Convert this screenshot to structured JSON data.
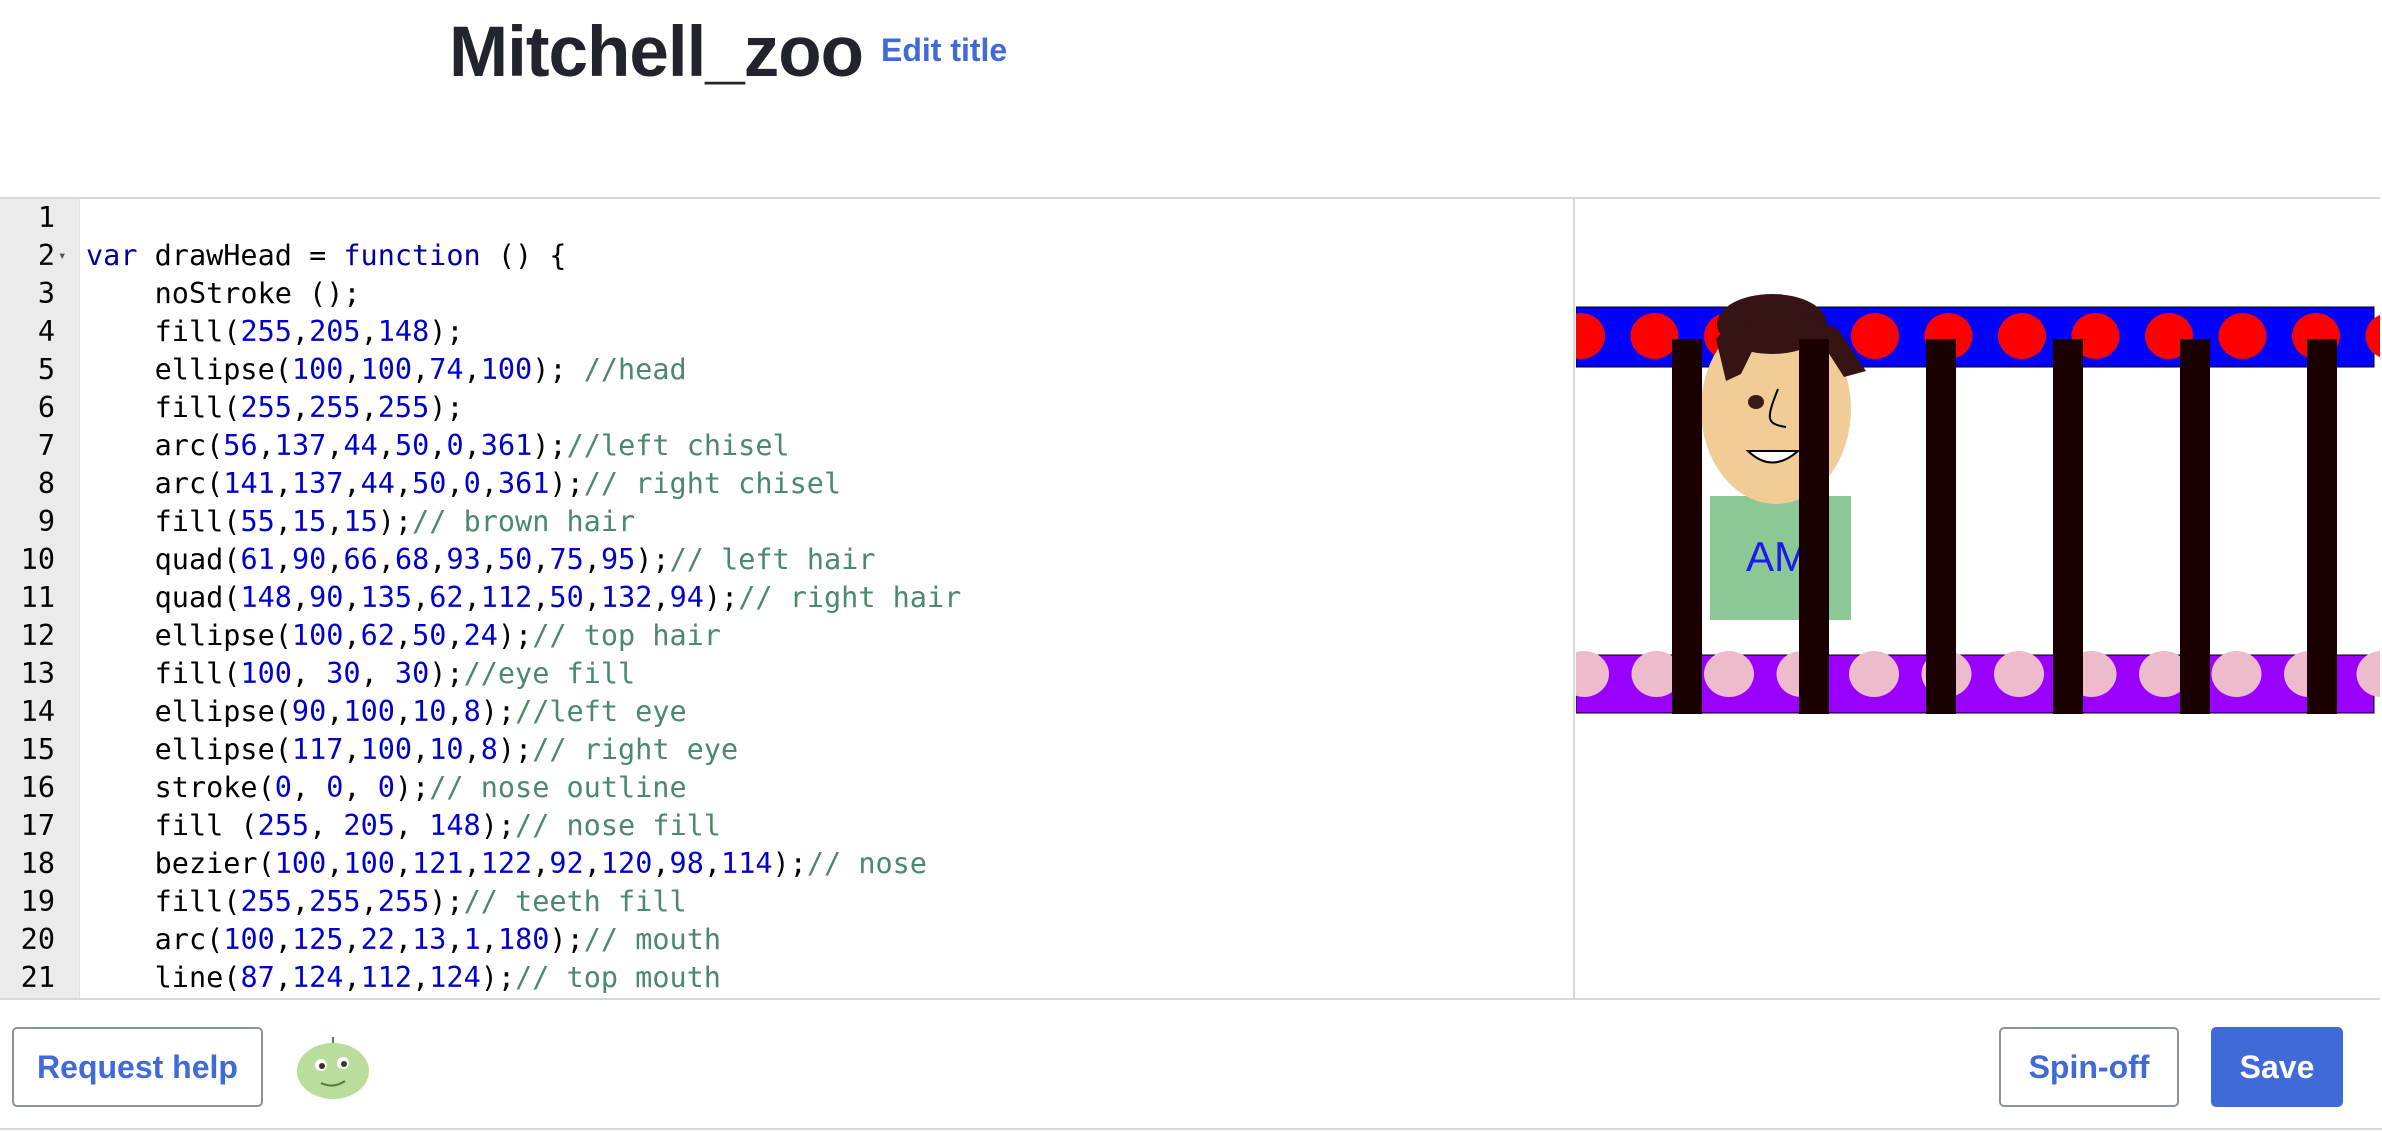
{
  "header": {
    "title": "Mitchell_zoo",
    "edit_title_label": "Edit title"
  },
  "editor": {
    "lines": [
      {
        "num": "1",
        "fold": false,
        "tokens": []
      },
      {
        "num": "2",
        "fold": true,
        "tokens": [
          [
            "kw",
            "var"
          ],
          [
            "fn",
            " drawHead = "
          ],
          [
            "kw",
            "function"
          ],
          [
            "fn",
            " () {"
          ]
        ]
      },
      {
        "num": "3",
        "fold": false,
        "tokens": [
          [
            "fn",
            "    noStroke ();"
          ]
        ]
      },
      {
        "num": "4",
        "fold": false,
        "tokens": [
          [
            "fn",
            "    fill("
          ],
          [
            "num",
            "255"
          ],
          [
            "fn",
            ","
          ],
          [
            "num",
            "205"
          ],
          [
            "fn",
            ","
          ],
          [
            "num",
            "148"
          ],
          [
            "fn",
            ");"
          ]
        ]
      },
      {
        "num": "5",
        "fold": false,
        "tokens": [
          [
            "fn",
            "    ellipse("
          ],
          [
            "num",
            "100"
          ],
          [
            "fn",
            ","
          ],
          [
            "num",
            "100"
          ],
          [
            "fn",
            ","
          ],
          [
            "num",
            "74"
          ],
          [
            "fn",
            ","
          ],
          [
            "num",
            "100"
          ],
          [
            "fn",
            "); "
          ],
          [
            "cm",
            "//head"
          ]
        ]
      },
      {
        "num": "6",
        "fold": false,
        "tokens": [
          [
            "fn",
            "    fill("
          ],
          [
            "num",
            "255"
          ],
          [
            "fn",
            ","
          ],
          [
            "num",
            "255"
          ],
          [
            "fn",
            ","
          ],
          [
            "num",
            "255"
          ],
          [
            "fn",
            ");"
          ]
        ]
      },
      {
        "num": "7",
        "fold": false,
        "tokens": [
          [
            "fn",
            "    arc("
          ],
          [
            "num",
            "56"
          ],
          [
            "fn",
            ","
          ],
          [
            "num",
            "137"
          ],
          [
            "fn",
            ","
          ],
          [
            "num",
            "44"
          ],
          [
            "fn",
            ","
          ],
          [
            "num",
            "50"
          ],
          [
            "fn",
            ","
          ],
          [
            "num",
            "0"
          ],
          [
            "fn",
            ","
          ],
          [
            "num",
            "361"
          ],
          [
            "fn",
            ");"
          ],
          [
            "cm",
            "//left chisel"
          ]
        ]
      },
      {
        "num": "8",
        "fold": false,
        "tokens": [
          [
            "fn",
            "    arc("
          ],
          [
            "num",
            "141"
          ],
          [
            "fn",
            ","
          ],
          [
            "num",
            "137"
          ],
          [
            "fn",
            ","
          ],
          [
            "num",
            "44"
          ],
          [
            "fn",
            ","
          ],
          [
            "num",
            "50"
          ],
          [
            "fn",
            ","
          ],
          [
            "num",
            "0"
          ],
          [
            "fn",
            ","
          ],
          [
            "num",
            "361"
          ],
          [
            "fn",
            ");"
          ],
          [
            "cm",
            "// right chisel"
          ]
        ]
      },
      {
        "num": "9",
        "fold": false,
        "tokens": [
          [
            "fn",
            "    fill("
          ],
          [
            "num",
            "55"
          ],
          [
            "fn",
            ","
          ],
          [
            "num",
            "15"
          ],
          [
            "fn",
            ","
          ],
          [
            "num",
            "15"
          ],
          [
            "fn",
            ");"
          ],
          [
            "cm",
            "// brown hair"
          ]
        ]
      },
      {
        "num": "10",
        "fold": false,
        "tokens": [
          [
            "fn",
            "    quad("
          ],
          [
            "num",
            "61"
          ],
          [
            "fn",
            ","
          ],
          [
            "num",
            "90"
          ],
          [
            "fn",
            ","
          ],
          [
            "num",
            "66"
          ],
          [
            "fn",
            ","
          ],
          [
            "num",
            "68"
          ],
          [
            "fn",
            ","
          ],
          [
            "num",
            "93"
          ],
          [
            "fn",
            ","
          ],
          [
            "num",
            "50"
          ],
          [
            "fn",
            ","
          ],
          [
            "num",
            "75"
          ],
          [
            "fn",
            ","
          ],
          [
            "num",
            "95"
          ],
          [
            "fn",
            ");"
          ],
          [
            "cm",
            "// left hair"
          ]
        ]
      },
      {
        "num": "11",
        "fold": false,
        "tokens": [
          [
            "fn",
            "    quad("
          ],
          [
            "num",
            "148"
          ],
          [
            "fn",
            ","
          ],
          [
            "num",
            "90"
          ],
          [
            "fn",
            ","
          ],
          [
            "num",
            "135"
          ],
          [
            "fn",
            ","
          ],
          [
            "num",
            "62"
          ],
          [
            "fn",
            ","
          ],
          [
            "num",
            "112"
          ],
          [
            "fn",
            ","
          ],
          [
            "num",
            "50"
          ],
          [
            "fn",
            ","
          ],
          [
            "num",
            "132"
          ],
          [
            "fn",
            ","
          ],
          [
            "num",
            "94"
          ],
          [
            "fn",
            ");"
          ],
          [
            "cm",
            "// right hair"
          ]
        ]
      },
      {
        "num": "12",
        "fold": false,
        "tokens": [
          [
            "fn",
            "    ellipse("
          ],
          [
            "num",
            "100"
          ],
          [
            "fn",
            ","
          ],
          [
            "num",
            "62"
          ],
          [
            "fn",
            ","
          ],
          [
            "num",
            "50"
          ],
          [
            "fn",
            ","
          ],
          [
            "num",
            "24"
          ],
          [
            "fn",
            ");"
          ],
          [
            "cm",
            "// top hair"
          ]
        ]
      },
      {
        "num": "13",
        "fold": false,
        "tokens": [
          [
            "fn",
            "    fill("
          ],
          [
            "num",
            "100"
          ],
          [
            "fn",
            ", "
          ],
          [
            "num",
            "30"
          ],
          [
            "fn",
            ", "
          ],
          [
            "num",
            "30"
          ],
          [
            "fn",
            ");"
          ],
          [
            "cm",
            "//eye fill"
          ]
        ]
      },
      {
        "num": "14",
        "fold": false,
        "tokens": [
          [
            "fn",
            "    ellipse("
          ],
          [
            "num",
            "90"
          ],
          [
            "fn",
            ","
          ],
          [
            "num",
            "100"
          ],
          [
            "fn",
            ","
          ],
          [
            "num",
            "10"
          ],
          [
            "fn",
            ","
          ],
          [
            "num",
            "8"
          ],
          [
            "fn",
            ");"
          ],
          [
            "cm",
            "//left eye"
          ]
        ]
      },
      {
        "num": "15",
        "fold": false,
        "tokens": [
          [
            "fn",
            "    ellipse("
          ],
          [
            "num",
            "117"
          ],
          [
            "fn",
            ","
          ],
          [
            "num",
            "100"
          ],
          [
            "fn",
            ","
          ],
          [
            "num",
            "10"
          ],
          [
            "fn",
            ","
          ],
          [
            "num",
            "8"
          ],
          [
            "fn",
            ");"
          ],
          [
            "cm",
            "// right eye"
          ]
        ]
      },
      {
        "num": "16",
        "fold": false,
        "tokens": [
          [
            "fn",
            "    stroke("
          ],
          [
            "num",
            "0"
          ],
          [
            "fn",
            ", "
          ],
          [
            "num",
            "0"
          ],
          [
            "fn",
            ", "
          ],
          [
            "num",
            "0"
          ],
          [
            "fn",
            ");"
          ],
          [
            "cm",
            "// nose outline"
          ]
        ]
      },
      {
        "num": "17",
        "fold": false,
        "tokens": [
          [
            "fn",
            "    fill ("
          ],
          [
            "num",
            "255"
          ],
          [
            "fn",
            ", "
          ],
          [
            "num",
            "205"
          ],
          [
            "fn",
            ", "
          ],
          [
            "num",
            "148"
          ],
          [
            "fn",
            ");"
          ],
          [
            "cm",
            "// nose fill"
          ]
        ]
      },
      {
        "num": "18",
        "fold": false,
        "tokens": [
          [
            "fn",
            "    bezier("
          ],
          [
            "num",
            "100"
          ],
          [
            "fn",
            ","
          ],
          [
            "num",
            "100"
          ],
          [
            "fn",
            ","
          ],
          [
            "num",
            "121"
          ],
          [
            "fn",
            ","
          ],
          [
            "num",
            "122"
          ],
          [
            "fn",
            ","
          ],
          [
            "num",
            "92"
          ],
          [
            "fn",
            ","
          ],
          [
            "num",
            "120"
          ],
          [
            "fn",
            ","
          ],
          [
            "num",
            "98"
          ],
          [
            "fn",
            ","
          ],
          [
            "num",
            "114"
          ],
          [
            "fn",
            ");"
          ],
          [
            "cm",
            "// nose"
          ]
        ]
      },
      {
        "num": "19",
        "fold": false,
        "tokens": [
          [
            "fn",
            "    fill("
          ],
          [
            "num",
            "255"
          ],
          [
            "fn",
            ","
          ],
          [
            "num",
            "255"
          ],
          [
            "fn",
            ","
          ],
          [
            "num",
            "255"
          ],
          [
            "fn",
            ");"
          ],
          [
            "cm",
            "// teeth fill"
          ]
        ]
      },
      {
        "num": "20",
        "fold": false,
        "tokens": [
          [
            "fn",
            "    arc("
          ],
          [
            "num",
            "100"
          ],
          [
            "fn",
            ","
          ],
          [
            "num",
            "125"
          ],
          [
            "fn",
            ","
          ],
          [
            "num",
            "22"
          ],
          [
            "fn",
            ","
          ],
          [
            "num",
            "13"
          ],
          [
            "fn",
            ","
          ],
          [
            "num",
            "1"
          ],
          [
            "fn",
            ","
          ],
          [
            "num",
            "180"
          ],
          [
            "fn",
            ");"
          ],
          [
            "cm",
            "// mouth"
          ]
        ]
      },
      {
        "num": "21",
        "fold": false,
        "tokens": [
          [
            "fn",
            "    line("
          ],
          [
            "num",
            "87"
          ],
          [
            "fn",
            ","
          ],
          [
            "num",
            "124"
          ],
          [
            "fn",
            ","
          ],
          [
            "num",
            "112"
          ],
          [
            "fn",
            ","
          ],
          [
            "num",
            "124"
          ],
          [
            "fn",
            ");"
          ],
          [
            "cm",
            "// top mouth"
          ]
        ]
      }
    ]
  },
  "canvas": {
    "shirt_text": "AM",
    "colors": {
      "top_band": "#0000ff",
      "top_dots": "#ff0000",
      "bottom_band": "#9900ff",
      "bottom_dots": "#eebbcc",
      "bars": "#1a0000",
      "skin": "#f2cc96",
      "hair": "#371414",
      "shirt": "#8cc896",
      "shirt_text": "#1a1aee"
    }
  },
  "footer": {
    "request_help_label": "Request help",
    "spinoff_label": "Spin-off",
    "save_label": "Save"
  }
}
